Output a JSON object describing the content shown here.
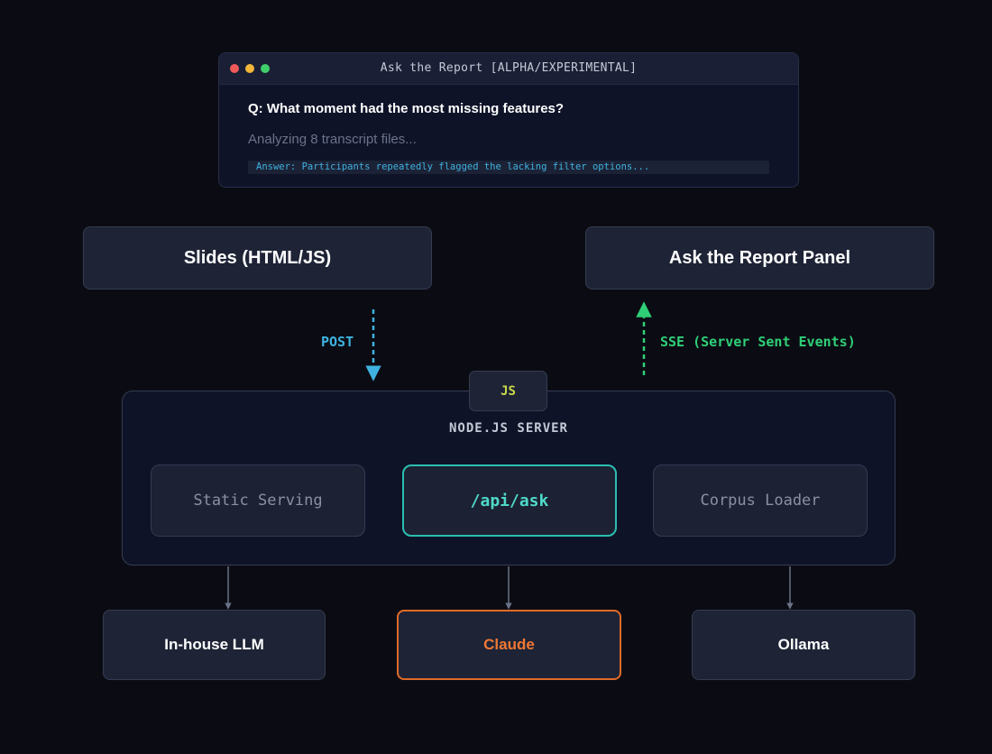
{
  "window": {
    "title": "Ask the Report [ALPHA/EXPERIMENTAL]",
    "question": "Q: What moment had the most missing features?",
    "status": "Analyzing 8 transcript files...",
    "answer": "Answer: Participants repeatedly flagged the lacking filter options..."
  },
  "top_boxes": {
    "slides": "Slides (HTML/JS)",
    "panel": "Ask the Report Panel"
  },
  "flows": {
    "post_label": "POST",
    "sse_label": "SSE (Server Sent Events)"
  },
  "server": {
    "badge": "JS",
    "title": "NODE.JS SERVER",
    "modules": {
      "static": "Static Serving",
      "api": "/api/ask",
      "corpus": "Corpus Loader"
    }
  },
  "providers": {
    "inhouse": "In-house LLM",
    "claude": "Claude",
    "ollama": "Ollama"
  },
  "colors": {
    "background": "#0b0c13",
    "post": "#3fb2e0",
    "sse": "#2fcf78",
    "api_highlight": "#2bbfb0",
    "claude_highlight": "#e06a28",
    "js_badge": "#c9d84a"
  }
}
